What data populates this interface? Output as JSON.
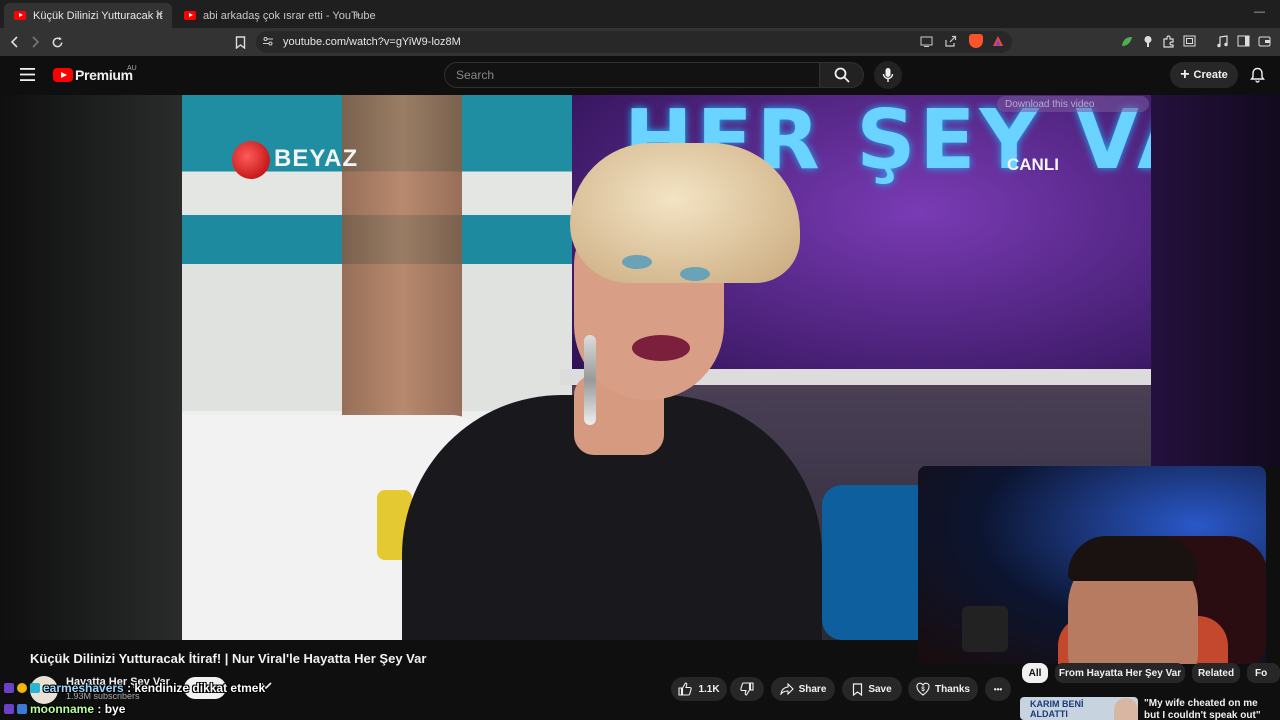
{
  "browser": {
    "tabs": [
      {
        "label": "Küçük Dilinizi Yutturacak İtiraf! |",
        "close": "✕"
      },
      {
        "label": "abi arkadaş çok ısrar etti - YouTube"
      }
    ],
    "new_tab": "+",
    "minimize": "—",
    "url": "youtube.com/watch?v=gYiW9-loz8M"
  },
  "youtube": {
    "brand": "Premium",
    "region": "AU",
    "search_placeholder": "Search",
    "create_label": "Create"
  },
  "video_overlay": {
    "channel_logo_text": "BEYAZ",
    "stage_text": "HER ŞEY VA",
    "live_label": "CANLI",
    "download_label": "Download this video"
  },
  "video_info": {
    "title": "Küçük Dilinizi Yutturacak İtiraf! | Nur Viral'le Hayatta Her Şey Var",
    "channel_name": "Hayatta Her Şey Var",
    "subscribers": "1.93M subscribers",
    "likes": "1.1K",
    "share_label": "Share",
    "save_label": "Save",
    "thanks_label": "Thanks",
    "more": "•••"
  },
  "sidebar": {
    "chips": [
      "All",
      "From Hayatta Her Şey Var",
      "Related",
      "Fo"
    ],
    "recommendation": {
      "thumb_text": "KARIM BENİ ALDATTI",
      "title": "\"My wife cheated on me but I couldn't speak out\""
    }
  },
  "chat": [
    {
      "user": "earmeshavers",
      "sep": " : ",
      "message": "kendinize dikkat etmek"
    },
    {
      "user": "moonname",
      "sep": " : ",
      "message": "bye"
    }
  ]
}
